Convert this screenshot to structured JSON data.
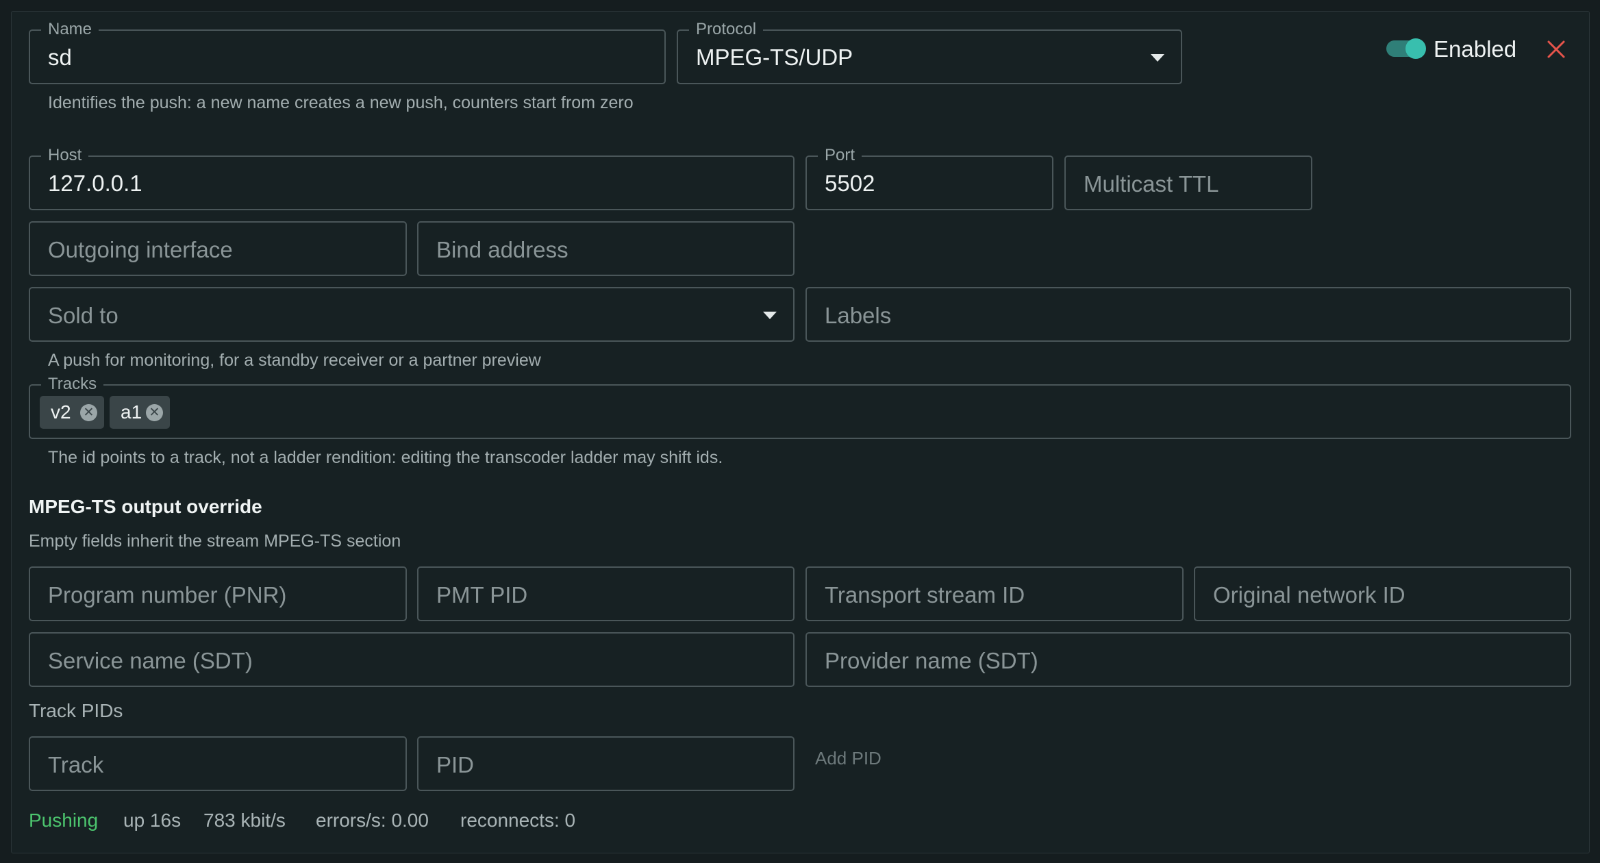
{
  "header": {
    "enabled_label": "Enabled",
    "enabled": true,
    "close_icon": "close-icon",
    "close_color": "#e5544b"
  },
  "fields": {
    "name": {
      "label": "Name",
      "value": "sd",
      "helper": "Identifies the push: a new name creates a new push, counters start from zero"
    },
    "protocol": {
      "label": "Protocol",
      "value": "MPEG-TS/UDP"
    },
    "host": {
      "label": "Host",
      "value": "127.0.0.1"
    },
    "port": {
      "label": "Port",
      "value": "5502"
    },
    "multicast_ttl": {
      "placeholder": "Multicast TTL"
    },
    "outgoing_interface": {
      "placeholder": "Outgoing interface"
    },
    "bind_address": {
      "placeholder": "Bind address"
    },
    "sold_to": {
      "placeholder": "Sold to",
      "helper": "A push for monitoring, for a standby receiver or a partner preview"
    },
    "labels": {
      "placeholder": "Labels"
    },
    "tracks": {
      "label": "Tracks",
      "chips": [
        "v2",
        "a1"
      ],
      "helper": "The id points to a track, not a ladder rendition: editing the transcoder ladder may shift ids."
    }
  },
  "mpegts": {
    "title": "MPEG-TS output override",
    "subtitle": "Empty fields inherit the stream MPEG-TS section",
    "program_number": "Program number (PNR)",
    "pmt_pid": "PMT PID",
    "transport_stream_id": "Transport stream ID",
    "original_network_id": "Original network ID",
    "service_name": "Service name (SDT)",
    "provider_name": "Provider name (SDT)",
    "track_pids_label": "Track PIDs",
    "track_placeholder": "Track",
    "pid_placeholder": "PID",
    "add_pid": "Add PID"
  },
  "status": {
    "state": "Pushing",
    "state_color": "#4cc46e",
    "uptime": "up 16s",
    "bitrate": "783 kbit/s",
    "errors": "errors/s: 0.00",
    "reconnects": "reconnects: 0"
  }
}
